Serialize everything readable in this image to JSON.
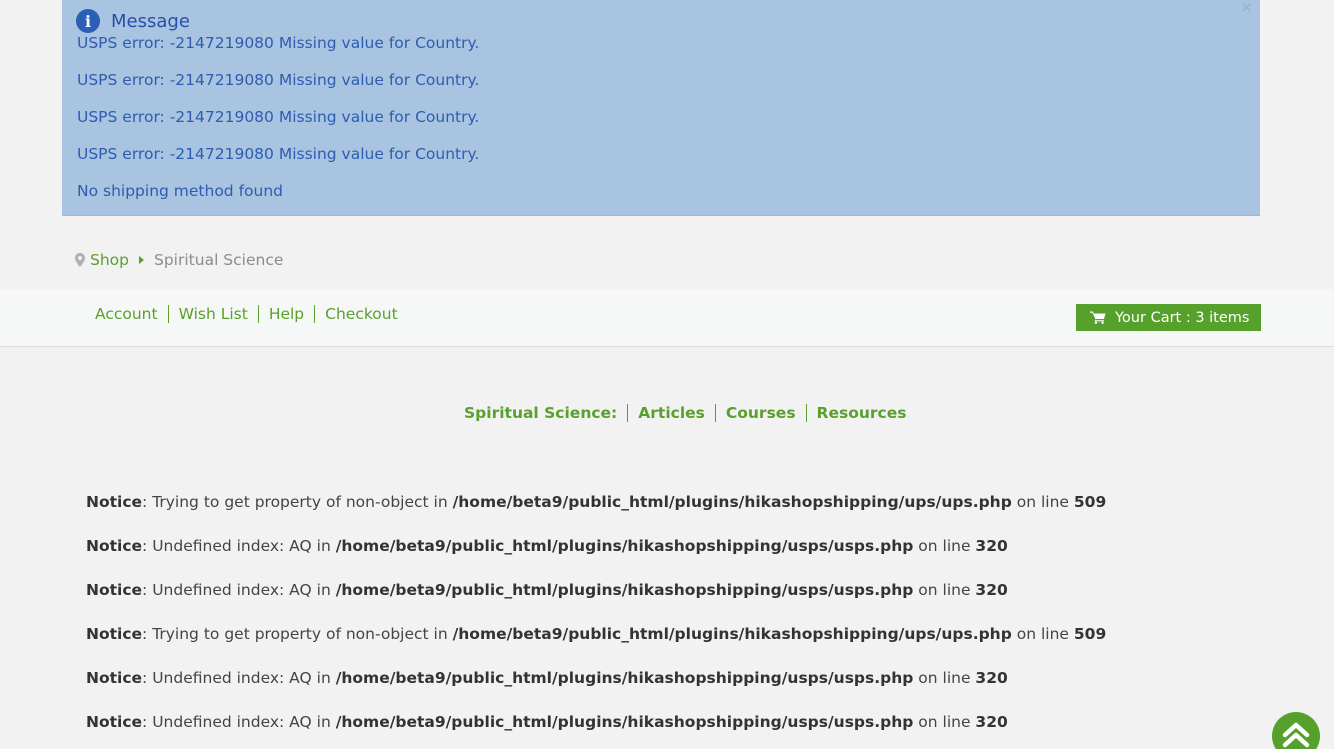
{
  "message": {
    "title": "Message",
    "close_label": "×",
    "lines": [
      "USPS error: -2147219080 Missing value for Country.",
      "USPS error: -2147219080 Missing value for Country.",
      "USPS error: -2147219080 Missing value for Country.",
      "USPS error: -2147219080 Missing value for Country.",
      "No shipping method found"
    ]
  },
  "breadcrumb": {
    "shop": "Shop",
    "current": "Spiritual Science"
  },
  "nav": {
    "links": [
      "Account",
      "Wish List",
      "Help",
      "Checkout"
    ],
    "cart_label": "Your Cart : 3 items"
  },
  "categories": {
    "label": "Spiritual Science:",
    "links": [
      "Articles",
      "Courses",
      "Resources"
    ]
  },
  "notices": [
    {
      "label": "Notice",
      "text1": ": Trying to get property of non-object in ",
      "path": "/home/beta9/public_html/plugins/hikashopshipping/ups/ups.php",
      "text2": " on line ",
      "line": "509"
    },
    {
      "label": "Notice",
      "text1": ": Undefined index: AQ in ",
      "path": "/home/beta9/public_html/plugins/hikashopshipping/usps/usps.php",
      "text2": " on line ",
      "line": "320"
    },
    {
      "label": "Notice",
      "text1": ": Undefined index: AQ in ",
      "path": "/home/beta9/public_html/plugins/hikashopshipping/usps/usps.php",
      "text2": " on line ",
      "line": "320"
    },
    {
      "label": "Notice",
      "text1": ": Trying to get property of non-object in ",
      "path": "/home/beta9/public_html/plugins/hikashopshipping/ups/ups.php",
      "text2": " on line ",
      "line": "509"
    },
    {
      "label": "Notice",
      "text1": ": Undefined index: AQ in ",
      "path": "/home/beta9/public_html/plugins/hikashopshipping/usps/usps.php",
      "text2": " on line ",
      "line": "320"
    },
    {
      "label": "Notice",
      "text1": ": Undefined index: AQ in ",
      "path": "/home/beta9/public_html/plugins/hikashopshipping/usps/usps.php",
      "text2": " on line ",
      "line": "320"
    }
  ],
  "colors": {
    "accent": "#5aa02c",
    "message_bg": "#a9c4e0",
    "message_text": "#2e5db0"
  },
  "icons": {
    "message": "info-icon",
    "breadcrumb": "map-pin-icon",
    "cart": "shopping-cart-icon",
    "scroll": "chevron-double-up-icon"
  }
}
